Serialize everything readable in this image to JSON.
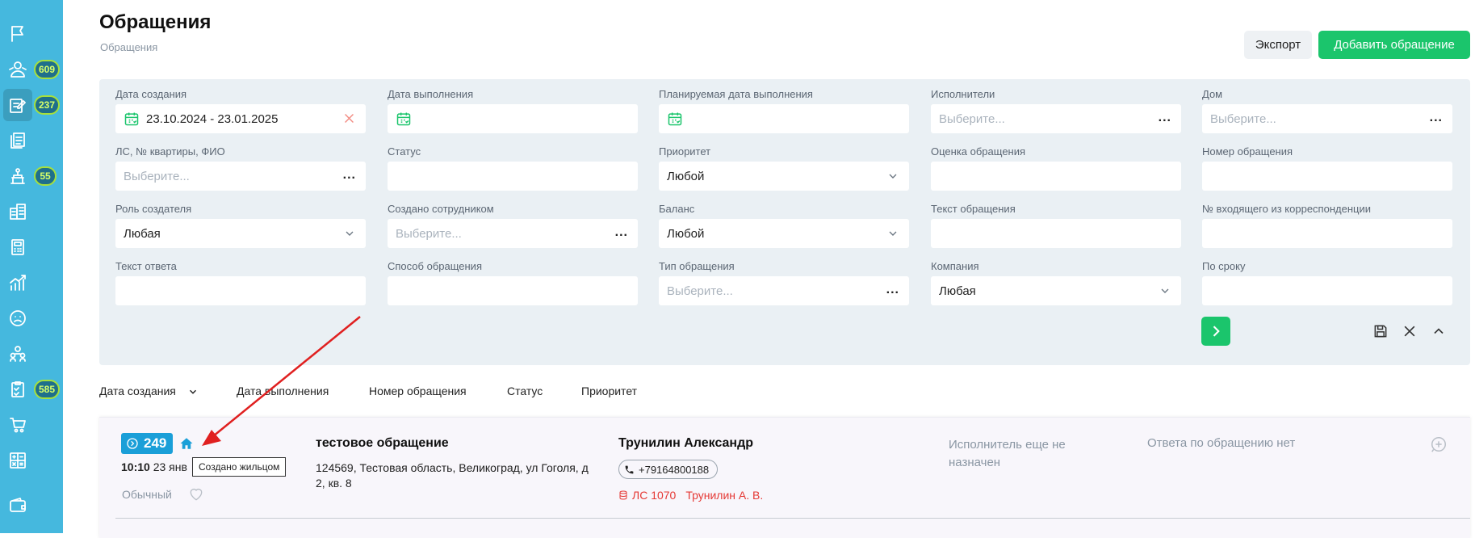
{
  "sidebar": {
    "items": [
      {
        "icon": "flag-icon",
        "badge": ""
      },
      {
        "icon": "users-icon",
        "badge": "609"
      },
      {
        "icon": "edit-request-icon",
        "badge": "237",
        "active": true
      },
      {
        "icon": "documents-icon",
        "badge": ""
      },
      {
        "icon": "service-icon",
        "badge": "55"
      },
      {
        "icon": "building-icon",
        "badge": ""
      },
      {
        "icon": "calculator-icon",
        "badge": ""
      },
      {
        "icon": "analytics-icon",
        "badge": ""
      },
      {
        "icon": "sad-face-icon",
        "badge": ""
      },
      {
        "icon": "team-icon",
        "badge": ""
      },
      {
        "icon": "checklist-icon",
        "badge": "585"
      },
      {
        "icon": "cart-icon",
        "badge": ""
      },
      {
        "icon": "math-grid-icon",
        "badge": ""
      },
      {
        "icon": "wallet-icon",
        "badge": ""
      }
    ],
    "badge_color": "#1f6f8b",
    "badge_border": "#a7e03b"
  },
  "header": {
    "title": "Обращения",
    "breadcrumb": "Обращения",
    "export_label": "Экспорт",
    "add_label": "Добавить обращение"
  },
  "filters": {
    "created_date": {
      "label": "Дата создания",
      "value": "23.10.2024 - 23.01.2025"
    },
    "done_date": {
      "label": "Дата выполнения",
      "value": ""
    },
    "planned_date": {
      "label": "Планируемая дата выполнения",
      "value": ""
    },
    "executors": {
      "label": "Исполнители",
      "placeholder": "Выберите..."
    },
    "house": {
      "label": "Дом",
      "placeholder": "Выберите..."
    },
    "account": {
      "label": "ЛС, № квартиры, ФИО",
      "placeholder": "Выберите..."
    },
    "status": {
      "label": "Статус",
      "value": ""
    },
    "priority": {
      "label": "Приоритет",
      "value": "Любой"
    },
    "rating": {
      "label": "Оценка обращения",
      "value": ""
    },
    "request_number": {
      "label": "Номер обращения",
      "value": ""
    },
    "creator_role": {
      "label": "Роль создателя",
      "value": "Любая"
    },
    "created_by_employee": {
      "label": "Создано сотрудником",
      "placeholder": "Выберите..."
    },
    "balance": {
      "label": "Баланс",
      "value": "Любой"
    },
    "request_text": {
      "label": "Текст обращения",
      "value": ""
    },
    "incoming_number": {
      "label": "№ входящего из корреспонденции",
      "value": ""
    },
    "answer_text": {
      "label": "Текст ответа",
      "value": ""
    },
    "request_method": {
      "label": "Способ обращения",
      "value": ""
    },
    "request_type": {
      "label": "Тип обращения",
      "placeholder": "Выберите..."
    },
    "company": {
      "label": "Компания",
      "value": "Любая"
    },
    "deadline": {
      "label": "По сроку",
      "value": ""
    },
    "dots": "..."
  },
  "sort": {
    "created": "Дата создания",
    "done": "Дата выполнения",
    "number": "Номер обращения",
    "status": "Статус",
    "priority": "Приоритет"
  },
  "request": {
    "number": "249",
    "time": "10:10",
    "date": "23 янв",
    "tooltip": "Создано жильцом",
    "priority": "Обычный",
    "subject": "тестовое обращение",
    "address": "124569, Тестовая область, Великоград, ул Гоголя, д 2, кв. 8",
    "applicant": "Трунилин Александр",
    "phone": "+79164800188",
    "account": "ЛС 1070",
    "account_name": "Трунилин А. В.",
    "executor": "Исполнитель еще не назначен",
    "answer": "Ответа по обращению нет"
  },
  "colors": {
    "sidebar": "#45b8de",
    "accent_green": "#1bc56c",
    "badge_blue": "#1a9fd8",
    "error_red": "#e53935",
    "annotation_arrow": "#e02020"
  }
}
